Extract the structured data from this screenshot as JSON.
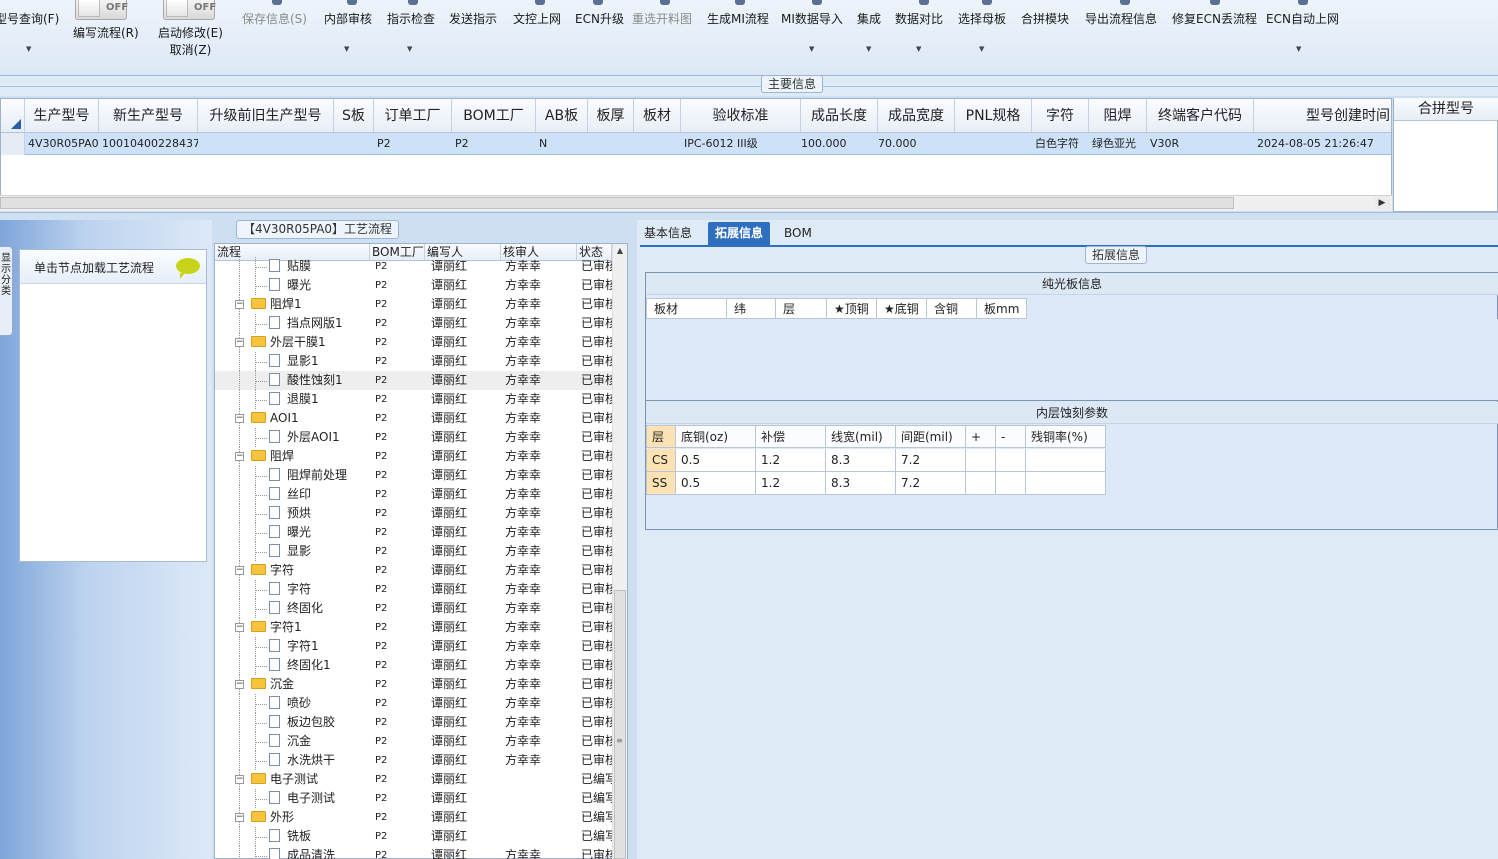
{
  "toolbar": {
    "toggles": [
      {
        "state": "OFF"
      },
      {
        "state": "OFF"
      }
    ],
    "buttons": [
      {
        "label": "型号查询(F)",
        "dropdown": true,
        "enabled": true
      },
      {
        "label": "编写流程(R)",
        "dropdown": false,
        "enabled": true
      },
      {
        "label": "启动修改(E)",
        "sub_label": "取消(Z)",
        "dropdown": false,
        "enabled": true
      },
      {
        "label": "保存信息(S)",
        "dropdown": false,
        "enabled": false
      },
      {
        "label": "内部审核",
        "dropdown": true,
        "enabled": true
      },
      {
        "label": "指示检查",
        "dropdown": true,
        "enabled": true
      },
      {
        "label": "发送指示",
        "dropdown": false,
        "enabled": true
      },
      {
        "label": "文控上网",
        "dropdown": false,
        "enabled": true
      },
      {
        "label": "ECN升级",
        "dropdown": false,
        "enabled": true
      },
      {
        "label": "重选开料图",
        "dropdown": false,
        "enabled": false
      },
      {
        "label": "生成MI流程",
        "dropdown": false,
        "enabled": true
      },
      {
        "label": "MI数据导入",
        "dropdown": true,
        "enabled": true
      },
      {
        "label": "集成",
        "dropdown": true,
        "enabled": true
      },
      {
        "label": "数据对比",
        "dropdown": true,
        "enabled": true
      },
      {
        "label": "选择母板",
        "dropdown": true,
        "enabled": true
      },
      {
        "label": "合拼模块",
        "dropdown": false,
        "enabled": true
      },
      {
        "label": "导出流程信息",
        "dropdown": false,
        "enabled": true
      },
      {
        "label": "修复ECN丢流程",
        "dropdown": false,
        "enabled": true
      },
      {
        "label": "ECN自动上网",
        "dropdown": true,
        "enabled": true
      }
    ]
  },
  "main_info": {
    "title": "主要信息",
    "columns": [
      "生产型号",
      "新生产型号",
      "升级前旧生产型号",
      "S板",
      "订单工厂",
      "BOM工厂",
      "AB板",
      "板厚",
      "板材",
      "验收标准",
      "成品长度",
      "成品宽度",
      "PNL规格",
      "字符",
      "阻焊",
      "终端客户代码",
      "型号创建时间"
    ],
    "rows": [
      [
        "4V30R05PA0",
        "10010400228437",
        "",
        "",
        "P2",
        "P2",
        "N",
        "",
        "",
        "IPC-6012 III级",
        "100.000",
        "70.000",
        "",
        "白色字符",
        "绿色亚光",
        "V30R",
        "2024-08-05 21:26:47"
      ]
    ],
    "merge_column": "合拼型号"
  },
  "left_panel": {
    "vertical_tab": "显示分类",
    "node_hint": "单击节点加载工艺流程"
  },
  "flow": {
    "title": "【4V30R05PA0】工艺流程",
    "columns": [
      "流程",
      "BOM工厂",
      "编写人",
      "核审人",
      "状态"
    ],
    "rows": [
      {
        "name": "贴膜",
        "level": 2,
        "bom": "P2",
        "writer": "谭丽红",
        "reviewer": "方幸幸",
        "status": "已审核"
      },
      {
        "name": "曝光",
        "level": 2,
        "bom": "P2",
        "writer": "谭丽红",
        "reviewer": "方幸幸",
        "status": "已审核"
      },
      {
        "name": "阻焊1",
        "level": 1,
        "bom": "P2",
        "writer": "谭丽红",
        "reviewer": "方幸幸",
        "status": "已审核"
      },
      {
        "name": "挡点网版1",
        "level": 2,
        "bom": "P2",
        "writer": "谭丽红",
        "reviewer": "方幸幸",
        "status": "已审核"
      },
      {
        "name": "外层干膜1",
        "level": 1,
        "bom": "P2",
        "writer": "谭丽红",
        "reviewer": "方幸幸",
        "status": "已审核"
      },
      {
        "name": "显影1",
        "level": 2,
        "bom": "P2",
        "writer": "谭丽红",
        "reviewer": "方幸幸",
        "status": "已审核"
      },
      {
        "name": "酸性蚀刻1",
        "level": 2,
        "bom": "P2",
        "writer": "谭丽红",
        "reviewer": "方幸幸",
        "status": "已审核",
        "selected": true
      },
      {
        "name": "退膜1",
        "level": 2,
        "bom": "P2",
        "writer": "谭丽红",
        "reviewer": "方幸幸",
        "status": "已审核"
      },
      {
        "name": "AOI1",
        "level": 1,
        "bom": "P2",
        "writer": "谭丽红",
        "reviewer": "方幸幸",
        "status": "已审核"
      },
      {
        "name": "外层AOI1",
        "level": 2,
        "bom": "P2",
        "writer": "谭丽红",
        "reviewer": "方幸幸",
        "status": "已审核"
      },
      {
        "name": "阻焊",
        "level": 1,
        "bom": "P2",
        "writer": "谭丽红",
        "reviewer": "方幸幸",
        "status": "已审核"
      },
      {
        "name": "阻焊前处理",
        "level": 2,
        "bom": "P2",
        "writer": "谭丽红",
        "reviewer": "方幸幸",
        "status": "已审核"
      },
      {
        "name": "丝印",
        "level": 2,
        "bom": "P2",
        "writer": "谭丽红",
        "reviewer": "方幸幸",
        "status": "已审核"
      },
      {
        "name": "预烘",
        "level": 2,
        "bom": "P2",
        "writer": "谭丽红",
        "reviewer": "方幸幸",
        "status": "已审核"
      },
      {
        "name": "曝光",
        "level": 2,
        "bom": "P2",
        "writer": "谭丽红",
        "reviewer": "方幸幸",
        "status": "已审核"
      },
      {
        "name": "显影",
        "level": 2,
        "bom": "P2",
        "writer": "谭丽红",
        "reviewer": "方幸幸",
        "status": "已审核"
      },
      {
        "name": "字符",
        "level": 1,
        "bom": "P2",
        "writer": "谭丽红",
        "reviewer": "方幸幸",
        "status": "已审核"
      },
      {
        "name": "字符",
        "level": 2,
        "bom": "P2",
        "writer": "谭丽红",
        "reviewer": "方幸幸",
        "status": "已审核"
      },
      {
        "name": "终固化",
        "level": 2,
        "bom": "P2",
        "writer": "谭丽红",
        "reviewer": "方幸幸",
        "status": "已审核"
      },
      {
        "name": "字符1",
        "level": 1,
        "bom": "P2",
        "writer": "谭丽红",
        "reviewer": "方幸幸",
        "status": "已审核"
      },
      {
        "name": "字符1",
        "level": 2,
        "bom": "P2",
        "writer": "谭丽红",
        "reviewer": "方幸幸",
        "status": "已审核"
      },
      {
        "name": "终固化1",
        "level": 2,
        "bom": "P2",
        "writer": "谭丽红",
        "reviewer": "方幸幸",
        "status": "已审核"
      },
      {
        "name": "沉金",
        "level": 1,
        "bom": "P2",
        "writer": "谭丽红",
        "reviewer": "方幸幸",
        "status": "已审核"
      },
      {
        "name": "喷砂",
        "level": 2,
        "bom": "P2",
        "writer": "谭丽红",
        "reviewer": "方幸幸",
        "status": "已审核"
      },
      {
        "name": "板边包胶",
        "level": 2,
        "bom": "P2",
        "writer": "谭丽红",
        "reviewer": "方幸幸",
        "status": "已审核"
      },
      {
        "name": "沉金",
        "level": 2,
        "bom": "P2",
        "writer": "谭丽红",
        "reviewer": "方幸幸",
        "status": "已审核"
      },
      {
        "name": "水洗烘干",
        "level": 2,
        "bom": "P2",
        "writer": "谭丽红",
        "reviewer": "方幸幸",
        "status": "已审核"
      },
      {
        "name": "电子测试",
        "level": 1,
        "bom": "P2",
        "writer": "谭丽红",
        "reviewer": "",
        "status": "已编写"
      },
      {
        "name": "电子测试",
        "level": 2,
        "bom": "P2",
        "writer": "谭丽红",
        "reviewer": "",
        "status": "已编写"
      },
      {
        "name": "外形",
        "level": 1,
        "bom": "P2",
        "writer": "谭丽红",
        "reviewer": "",
        "status": "已编写"
      },
      {
        "name": "铣板",
        "level": 2,
        "bom": "P2",
        "writer": "谭丽红",
        "reviewer": "",
        "status": "已编写"
      },
      {
        "name": "成品清洗",
        "level": 2,
        "bom": "P2",
        "writer": "谭丽红",
        "reviewer": "方幸幸",
        "status": "已审核"
      }
    ]
  },
  "right_panel": {
    "tabs": [
      {
        "label": "基本信息",
        "active": false
      },
      {
        "label": "拓展信息",
        "active": true
      },
      {
        "label": "BOM",
        "active": false
      }
    ],
    "group_title": "拓展信息",
    "bare_board": {
      "title": "纯光板信息",
      "columns": [
        "板材",
        "纬",
        "层",
        "★顶铜",
        "★底铜",
        "含铜",
        "板mm"
      ]
    },
    "inner_etch": {
      "title": "内层蚀刻参数",
      "columns": [
        "层",
        "底铜(oz)",
        "补偿",
        "线宽(mil)",
        "间距(mil)",
        "+",
        "-",
        "残铜率(%)"
      ],
      "rows": [
        [
          "CS",
          "0.5",
          "1.2",
          "8.3",
          "7.2",
          "",
          "",
          ""
        ],
        [
          "SS",
          "0.5",
          "1.2",
          "8.3",
          "7.2",
          "",
          "",
          ""
        ]
      ]
    }
  },
  "colors": {
    "selected_row": "#cde2f8",
    "active_tab": "#2f6fbf",
    "row_header": "#fde3b3",
    "folder": "#f6c53d"
  }
}
